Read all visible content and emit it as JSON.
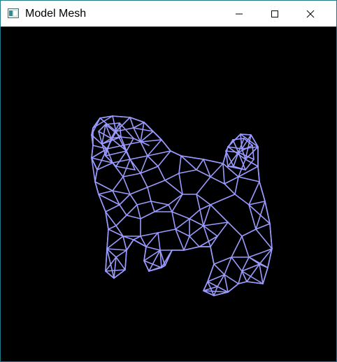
{
  "window": {
    "title": "Model Mesh",
    "controls": {
      "minimize_icon": "minimize-icon",
      "maximize_icon": "maximize-icon",
      "close_icon": "close-icon"
    }
  },
  "viewport": {
    "background": "#000000",
    "mesh_color": "#9b9bff",
    "model": "dog"
  }
}
